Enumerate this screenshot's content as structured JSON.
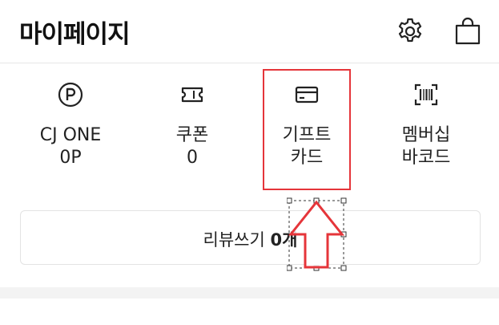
{
  "header": {
    "title": "마이페이지",
    "icons": [
      "gear-icon",
      "shopping-bag-icon"
    ]
  },
  "menu": {
    "items": [
      {
        "icon": "cj-one-point-icon",
        "line1": "CJ ONE",
        "line2": "0P"
      },
      {
        "icon": "coupon-icon",
        "line1": "쿠폰",
        "line2": "0"
      },
      {
        "icon": "gift-card-icon",
        "line1": "기프트",
        "line2": "카드"
      },
      {
        "icon": "barcode-icon",
        "line1": "멤버십",
        "line2": "바코드"
      }
    ]
  },
  "review": {
    "label": "리뷰쓰기",
    "count": "0개"
  },
  "colors": {
    "highlight": "#e5353a",
    "text": "#1a1a1a",
    "border": "#e3e3e3"
  }
}
